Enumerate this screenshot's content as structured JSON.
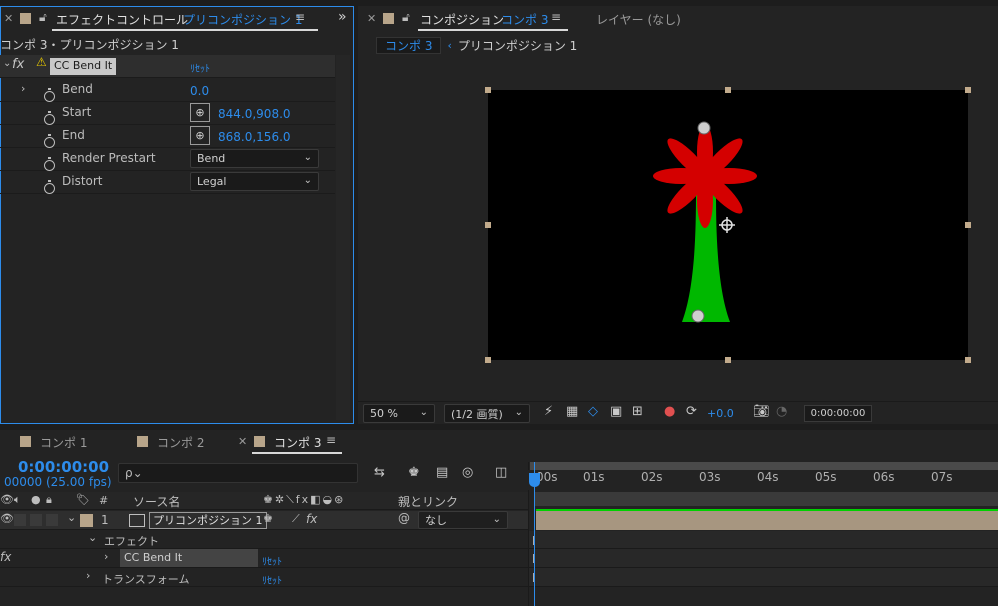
{
  "effect_panel": {
    "tab_title": "エフェクトコントロール",
    "tab_layer": "プリコンポジション 1",
    "breadcrumb": "コンポ 3・プリコンポジション 1",
    "effect_name": "CC Bend It",
    "reset_label": "ﾘｾｯﾄ",
    "params": [
      {
        "label": "Bend",
        "value": "0.0"
      },
      {
        "label": "Start",
        "value": "844.0,908.0"
      },
      {
        "label": "End",
        "value": "868.0,156.0"
      },
      {
        "label": "Render Prestart",
        "value": "Bend"
      },
      {
        "label": "Distort",
        "value": "Legal"
      }
    ]
  },
  "comp_panel": {
    "tab_title": "コンポジション",
    "tab_comp": "コンポ 3",
    "layer_tab": "レイヤー (なし)",
    "crumb_active": "コンポ 3",
    "crumb_next": "プリコンポジション 1",
    "zoom": "50 %",
    "resolution": "(1/2 画質)",
    "exposure": "+0.0",
    "timecode": "0:00:00:00"
  },
  "timeline": {
    "tabs": [
      "コンポ 1",
      "コンポ 2",
      "コンポ 3"
    ],
    "timecode": "0:00:00:00",
    "frame_fps": "00000 (25.00 fps)",
    "search_placeholder": "ρ⌄",
    "col_hash": "#",
    "col_source": "ソース名",
    "col_parent": "親とリンク",
    "layer_num": "1",
    "layer_name": "プリコンポジション 1",
    "parent_value": "なし",
    "effect_group": "エフェクト",
    "effect_item": "CC Bend It",
    "transform_group": "トランスフォーム",
    "reset_label": "ﾘｾｯﾄ",
    "ruler": [
      "00s",
      "01s",
      "02s",
      "03s",
      "04s",
      "05s",
      "06s",
      "07s"
    ]
  },
  "colors": {
    "accent": "#2d8ceb",
    "petal": "#d40000",
    "stem": "#00b800",
    "label_swatch": "#b8a58a"
  }
}
